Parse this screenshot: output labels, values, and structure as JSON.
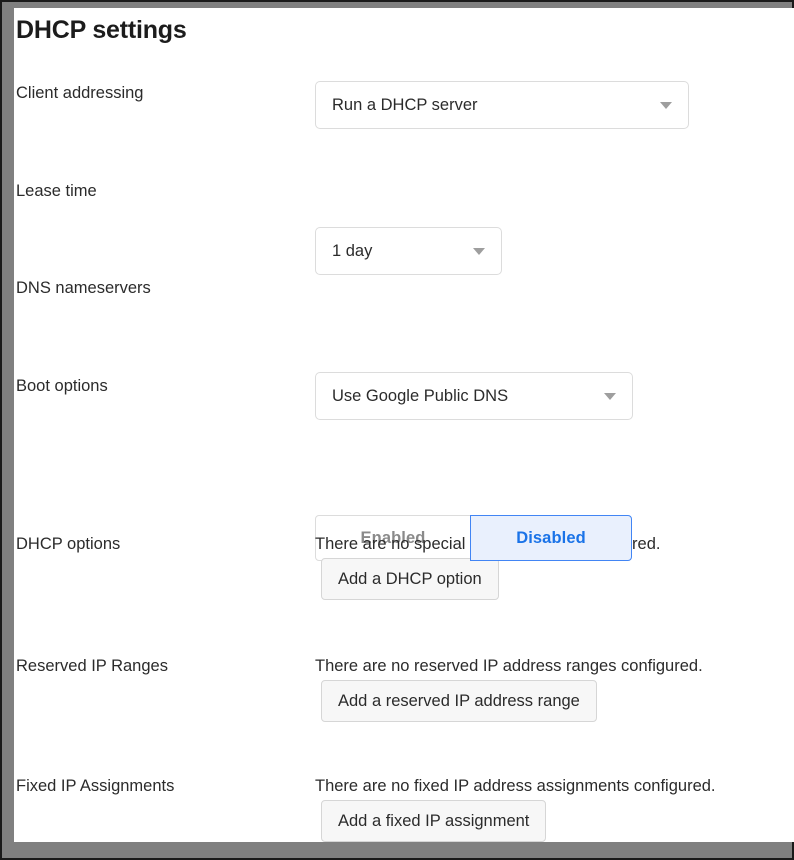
{
  "page": {
    "title": "DHCP settings",
    "accent_color": "#1a73e8",
    "accent_bg_color": "#e9f0fd",
    "border_color": "#dcdcdc",
    "frame_color": "#808080"
  },
  "rows": {
    "client_addressing": {
      "label": "Client addressing",
      "control": "select",
      "value": "Run a DHCP server",
      "caret_icon": "chevron-down-icon"
    },
    "lease_time": {
      "label": "Lease time",
      "control": "select",
      "value": "1 day",
      "caret_icon": "chevron-down-icon"
    },
    "dns_nameservers": {
      "label": "DNS nameservers",
      "control": "select",
      "value": "Use Google Public DNS",
      "caret_icon": "chevron-down-icon"
    },
    "boot_options": {
      "label": "Boot options",
      "control": "segmented",
      "options": [
        "Enabled",
        "Disabled"
      ],
      "selected": "Disabled"
    },
    "dhcp_options": {
      "label": "DHCP options",
      "empty_text": "There are no special DHCP options configured.",
      "button_label": "Add a DHCP option"
    },
    "reserved_ip_ranges": {
      "label": "Reserved IP Ranges",
      "empty_text": "There are no reserved IP address ranges configured.",
      "button_label": "Add a reserved IP address range"
    },
    "fixed_ip_assignments": {
      "label": "Fixed IP Assignments",
      "empty_text": "There are no fixed IP address assignments configured.",
      "button_label": "Add a fixed IP assignment"
    }
  }
}
